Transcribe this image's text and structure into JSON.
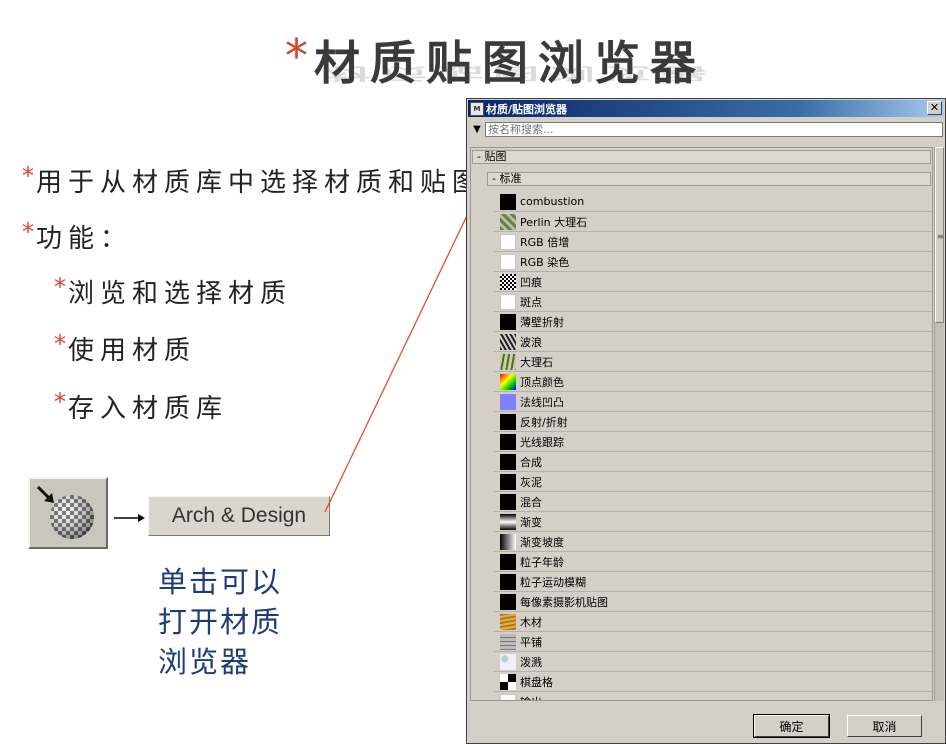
{
  "slide": {
    "title": "材质贴图浏览器",
    "bullets": [
      {
        "text": "用于从材质库中选择材质和贴图",
        "level": 1
      },
      {
        "text": "功能：",
        "level": 1
      },
      {
        "text": "浏览和选择材质",
        "level": 2
      },
      {
        "text": "使用材质",
        "level": 2
      },
      {
        "text": "存入材质库",
        "level": 2
      }
    ],
    "arch_button_label": "Arch & Design",
    "caption": [
      "单击可以",
      "打开材质",
      "浏览器"
    ],
    "colors": {
      "accent_star": "#d9412c",
      "caption": "#1f3b7a",
      "pointer_line": "#e0502a"
    }
  },
  "dialog": {
    "title": "材质/贴图浏览器",
    "app_icon": "3ds-max-icon",
    "search_placeholder": "按名称搜索...",
    "group_label": "- 贴图",
    "subgroup_label": "- 标准",
    "items": [
      {
        "label": "combustion",
        "swatch": "black"
      },
      {
        "label": "Perlin 大理石",
        "swatch": "perlin"
      },
      {
        "label": "RGB 倍增",
        "swatch": "white"
      },
      {
        "label": "RGB 染色",
        "swatch": "white"
      },
      {
        "label": "凹痕",
        "swatch": "dent"
      },
      {
        "label": "斑点",
        "swatch": "white"
      },
      {
        "label": "薄壁折射",
        "swatch": "black"
      },
      {
        "label": "波浪",
        "swatch": "waves"
      },
      {
        "label": "大理石",
        "swatch": "marble"
      },
      {
        "label": "顶点颜色",
        "swatch": "vertex"
      },
      {
        "label": "法线凹凸",
        "swatch": "normal"
      },
      {
        "label": "反射/折射",
        "swatch": "black"
      },
      {
        "label": "光线跟踪",
        "swatch": "black"
      },
      {
        "label": "合成",
        "swatch": "black"
      },
      {
        "label": "灰泥",
        "swatch": "black"
      },
      {
        "label": "混合",
        "swatch": "black"
      },
      {
        "label": "渐变",
        "swatch": "gradient"
      },
      {
        "label": "渐变坡度",
        "swatch": "ramp"
      },
      {
        "label": "粒子年龄",
        "swatch": "black"
      },
      {
        "label": "粒子运动模糊",
        "swatch": "black"
      },
      {
        "label": "每像素摄影机贴图",
        "swatch": "black"
      },
      {
        "label": "木材",
        "swatch": "wood"
      },
      {
        "label": "平铺",
        "swatch": "tiles"
      },
      {
        "label": "泼溅",
        "swatch": "splat"
      },
      {
        "label": "棋盘格",
        "swatch": "checker"
      },
      {
        "label": "输出",
        "swatch": "white"
      }
    ],
    "ok_label": "确定",
    "cancel_label": "取消",
    "close_label": "✕"
  }
}
